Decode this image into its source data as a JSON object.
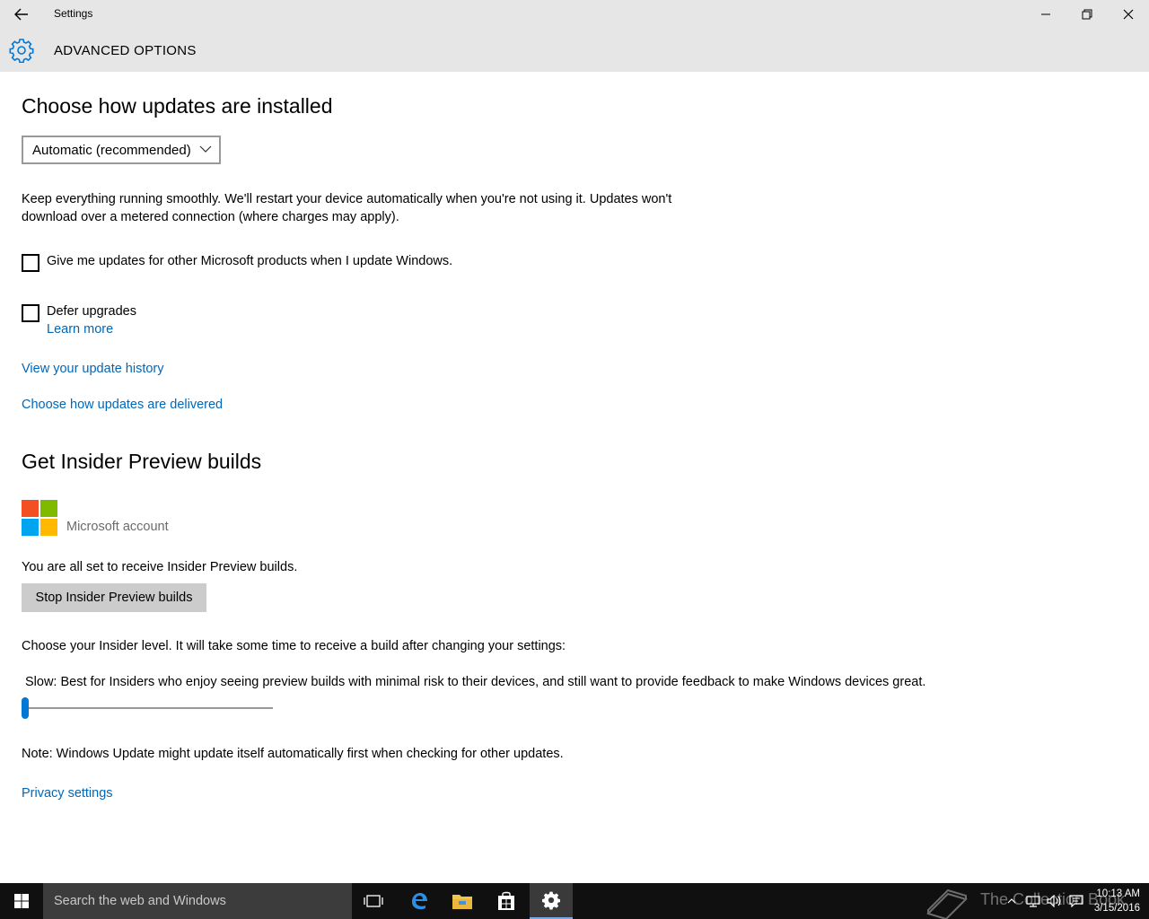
{
  "window": {
    "title": "Settings",
    "header": "ADVANCED OPTIONS"
  },
  "install": {
    "heading": "Choose how updates are installed",
    "dropdown_value": "Automatic (recommended)",
    "description_line1": "Keep everything running smoothly. We'll restart your device automatically when you're not using it. Updates won't",
    "description_line2": "download over a metered connection (where charges may apply).",
    "checkbox_other_products": "Give me updates for other Microsoft products when I update Windows.",
    "checkbox_defer": "Defer upgrades",
    "learn_more": "Learn more",
    "link_history": "View your update history",
    "link_delivery": "Choose how updates are delivered"
  },
  "insider": {
    "heading": "Get Insider Preview builds",
    "account_label": "Microsoft account",
    "status_text": "You are all set to receive Insider Preview builds.",
    "stop_button": "Stop Insider Preview builds",
    "level_prompt": "Choose your Insider level. It will take some time to receive a build after changing your settings:",
    "level_description": "Slow: Best for Insiders who enjoy seeing preview builds with minimal risk to their devices, and still want to provide feedback to make Windows devices great.",
    "level_slider_value": 0
  },
  "footer": {
    "note": "Note: Windows Update might update itself automatically first when checking for other updates.",
    "privacy_link": "Privacy settings"
  },
  "taskbar": {
    "search_placeholder": "Search the web and Windows",
    "watermark": "The Collection Book",
    "time": "10:13 AM",
    "date": "3/15/2016"
  },
  "colors": {
    "accent": "#0078d7",
    "link": "#0067b8",
    "chrome": "#e6e6e6",
    "taskbar": "#101010"
  }
}
